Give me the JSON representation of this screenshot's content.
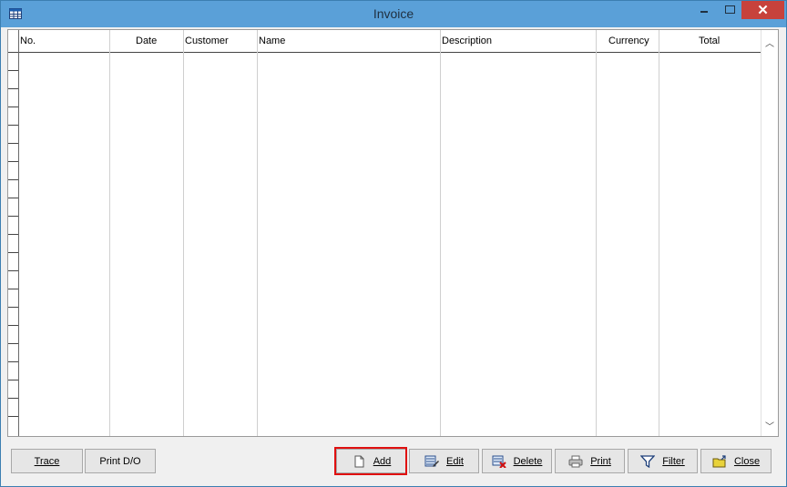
{
  "window": {
    "title": "Invoice"
  },
  "grid": {
    "columns": [
      "No.",
      "Date",
      "Customer",
      "Name",
      "Description",
      "Currency",
      "Total"
    ]
  },
  "buttons": {
    "trace": "Trace",
    "print_do": "Print D/O",
    "add": "Add",
    "edit": "Edit",
    "delete": "Delete",
    "print": "Print",
    "filter": "Filter",
    "close": "Close"
  },
  "icons": {
    "app": "grid-table-icon",
    "add": "new-document-icon",
    "edit": "edit-list-icon",
    "delete": "delete-list-icon",
    "print": "printer-icon",
    "filter": "filter-icon",
    "close": "folder-exit-icon"
  },
  "colors": {
    "titlebar": "#5aa0d8",
    "close_button": "#c7423c",
    "highlight": "#e01010"
  }
}
